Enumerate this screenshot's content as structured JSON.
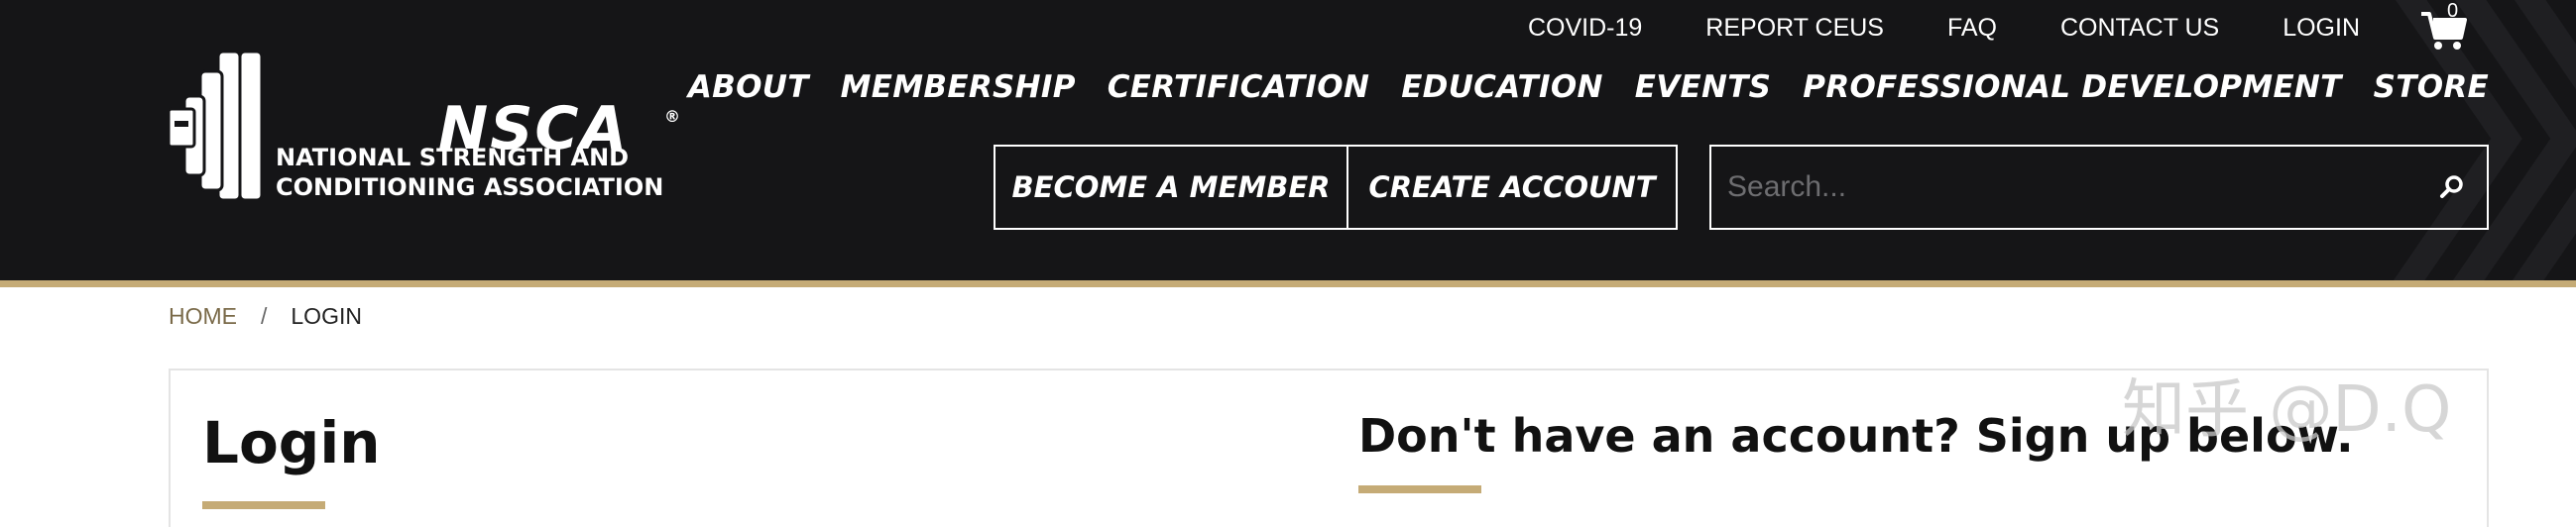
{
  "colors": {
    "header_bg": "#151517",
    "accent_gold": "#c5ab76",
    "text_white": "#ffffff"
  },
  "logo": {
    "wordmark": "NSCA",
    "registered": "®",
    "line1": "NATIONAL STRENGTH AND",
    "line2": "CONDITIONING ASSOCIATION"
  },
  "utility_nav": {
    "items": [
      "COVID-19",
      "REPORT CEUS",
      "FAQ",
      "CONTACT US",
      "LOGIN"
    ],
    "cart_count": "0",
    "cart_icon": "shopping-cart-icon"
  },
  "main_nav": {
    "items": [
      "ABOUT",
      "MEMBERSHIP",
      "CERTIFICATION",
      "EDUCATION",
      "EVENTS",
      "PROFESSIONAL DEVELOPMENT",
      "STORE"
    ]
  },
  "cta": {
    "become_member": "BECOME A MEMBER",
    "create_account": "CREATE ACCOUNT"
  },
  "search": {
    "placeholder": "Search...",
    "icon": "search-icon"
  },
  "breadcrumb": {
    "home": "HOME",
    "separator": "/",
    "current": "LOGIN"
  },
  "login": {
    "title": "Login"
  },
  "signup": {
    "title": "Don't have an account? Sign up below."
  },
  "watermark": "知乎 @D.Q"
}
